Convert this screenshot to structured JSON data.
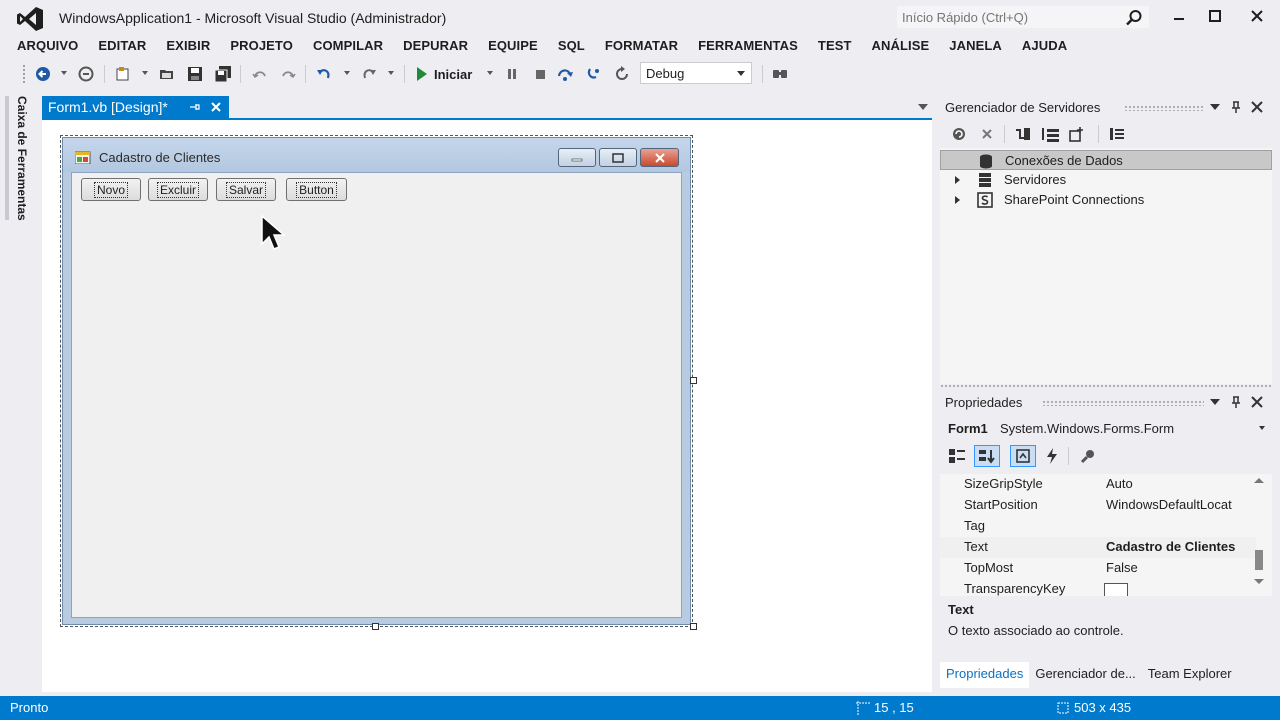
{
  "window": {
    "title": "WindowsApplication1 - Microsoft Visual Studio (Administrador)",
    "quick_launch_placeholder": "Início Rápido (Ctrl+Q)"
  },
  "menu": [
    "ARQUIVO",
    "EDITAR",
    "EXIBIR",
    "PROJETO",
    "COMPILAR",
    "DEPURAR",
    "EQUIPE",
    "SQL",
    "FORMATAR",
    "FERRAMENTAS",
    "TEST",
    "ANÁLISE",
    "JANELA",
    "AJUDA"
  ],
  "toolbar": {
    "start_label": "Iniciar",
    "configuration": "Debug"
  },
  "toolbox": {
    "label": "Caixa de Ferramentas"
  },
  "document_tab": {
    "label": "Form1.vb [Design]*"
  },
  "design_form": {
    "title": "Cadastro de Clientes",
    "buttons": [
      "Novo",
      "Excluir",
      "Salvar",
      "Button"
    ]
  },
  "server_explorer": {
    "title": "Gerenciador de Servidores",
    "nodes": [
      {
        "label": "Conexões de Dados",
        "icon": "database-connections-icon",
        "selected": true
      },
      {
        "label": "Servidores",
        "icon": "server-icon",
        "selected": false
      },
      {
        "label": "SharePoint Connections",
        "icon": "sharepoint-icon",
        "selected": false
      }
    ]
  },
  "properties": {
    "title": "Propriedades",
    "object_name": "Form1",
    "object_type": "System.Windows.Forms.Form",
    "rows": [
      {
        "name": "SizeGripStyle",
        "value": "Auto"
      },
      {
        "name": "StartPosition",
        "value": "WindowsDefaultLocat"
      },
      {
        "name": "Tag",
        "value": ""
      },
      {
        "name": "Text",
        "value": "Cadastro de Clientes"
      },
      {
        "name": "TopMost",
        "value": "False"
      },
      {
        "name": "TransparencyKey",
        "value": ""
      }
    ],
    "description_title": "Text",
    "description_text": "O texto associado ao controle."
  },
  "bottom_tabs": [
    "Propriedades",
    "Gerenciador de...",
    "Team Explorer"
  ],
  "status": {
    "text": "Pronto",
    "position": "15 , 15",
    "size": "503 x 435"
  },
  "colors": {
    "accent": "#007acc",
    "chrome": "#eeeef2"
  }
}
